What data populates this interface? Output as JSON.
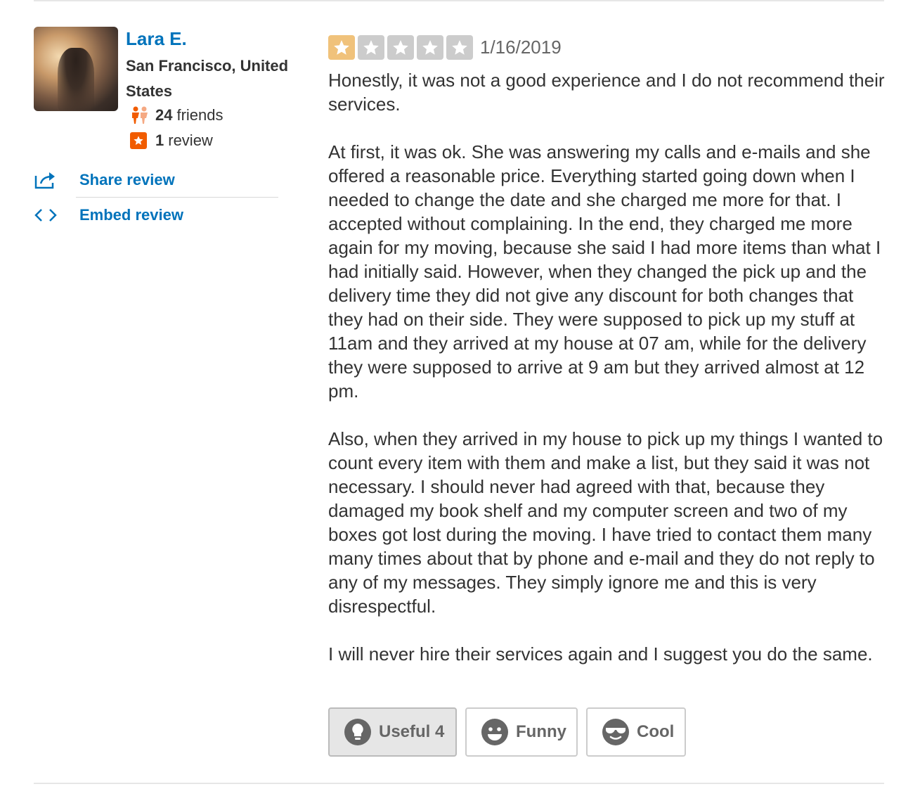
{
  "user": {
    "name": "Lara E.",
    "location": "San Francisco, United States",
    "friends_count": "24",
    "friends_label": "friends",
    "review_count": "1",
    "review_label": "review"
  },
  "actions": {
    "share_label": "Share review",
    "embed_label": "Embed review"
  },
  "review": {
    "rating": 1,
    "rating_max": 5,
    "date": "1/16/2019",
    "paragraphs": [
      "Honestly, it was not a good experience and I do not recommend their services.",
      "At first, it was ok. She was answering my calls and e-mails and she offered a reasonable price. Everything started going down when I needed to change the date and she charged me more for that. I accepted without complaining. In the end, they charged me more again for my moving, because she said I had more items than what I had initially said. However, when they changed the pick up and the delivery time they did not give any discount for both changes that they had on their side. They were supposed to pick up my stuff at 11am and they arrived at my house at 07 am, while for the delivery they were supposed to arrive at 9 am but they arrived almost at 12 pm.",
      "Also, when they arrived in my house to pick up my things I wanted to count every item with them and make a list, but they said it was not necessary. I should never had agreed with that, because they damaged my book shelf and my computer screen and two of my boxes got lost during the moving. I have tried to contact them many many times about that by phone and e-mail and they do not reply to any of my messages. They simply ignore me and this is very disrespectful.",
      "I will never hire their services again and I suggest you do the same."
    ]
  },
  "votes": {
    "useful_label": "Useful 4",
    "funny_label": "Funny",
    "cool_label": "Cool"
  },
  "colors": {
    "link": "#0073bb",
    "star_filled": "#f0c27b",
    "star_empty": "#cccccc",
    "review_badge": "#f15c00"
  }
}
